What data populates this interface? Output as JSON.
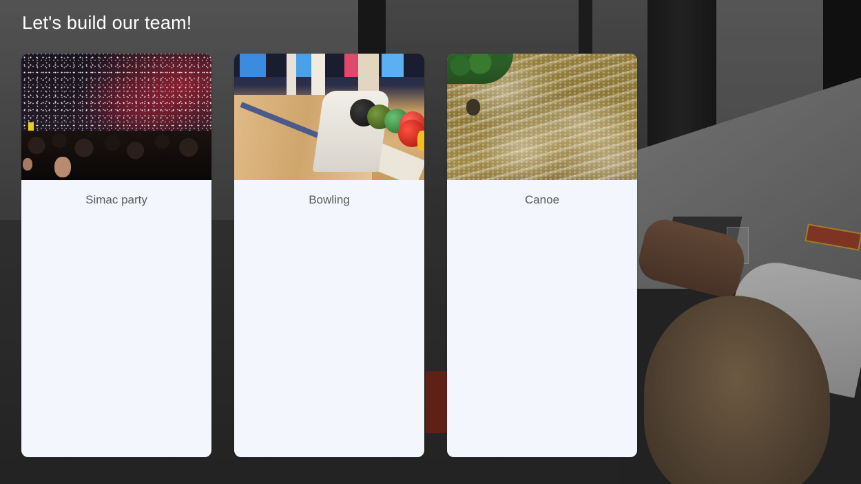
{
  "page": {
    "title": "Let's build our team!"
  },
  "activities": [
    {
      "label": "Simac party",
      "image": "concert-crowd-with-confetti"
    },
    {
      "label": "Bowling",
      "image": "bowling-ball-return"
    },
    {
      "label": "Canoe",
      "image": "whitewater-river"
    }
  ],
  "colors": {
    "card_background": "#f3f6fd",
    "title_text": "#ffffff",
    "card_text": "#5a5a5a"
  }
}
